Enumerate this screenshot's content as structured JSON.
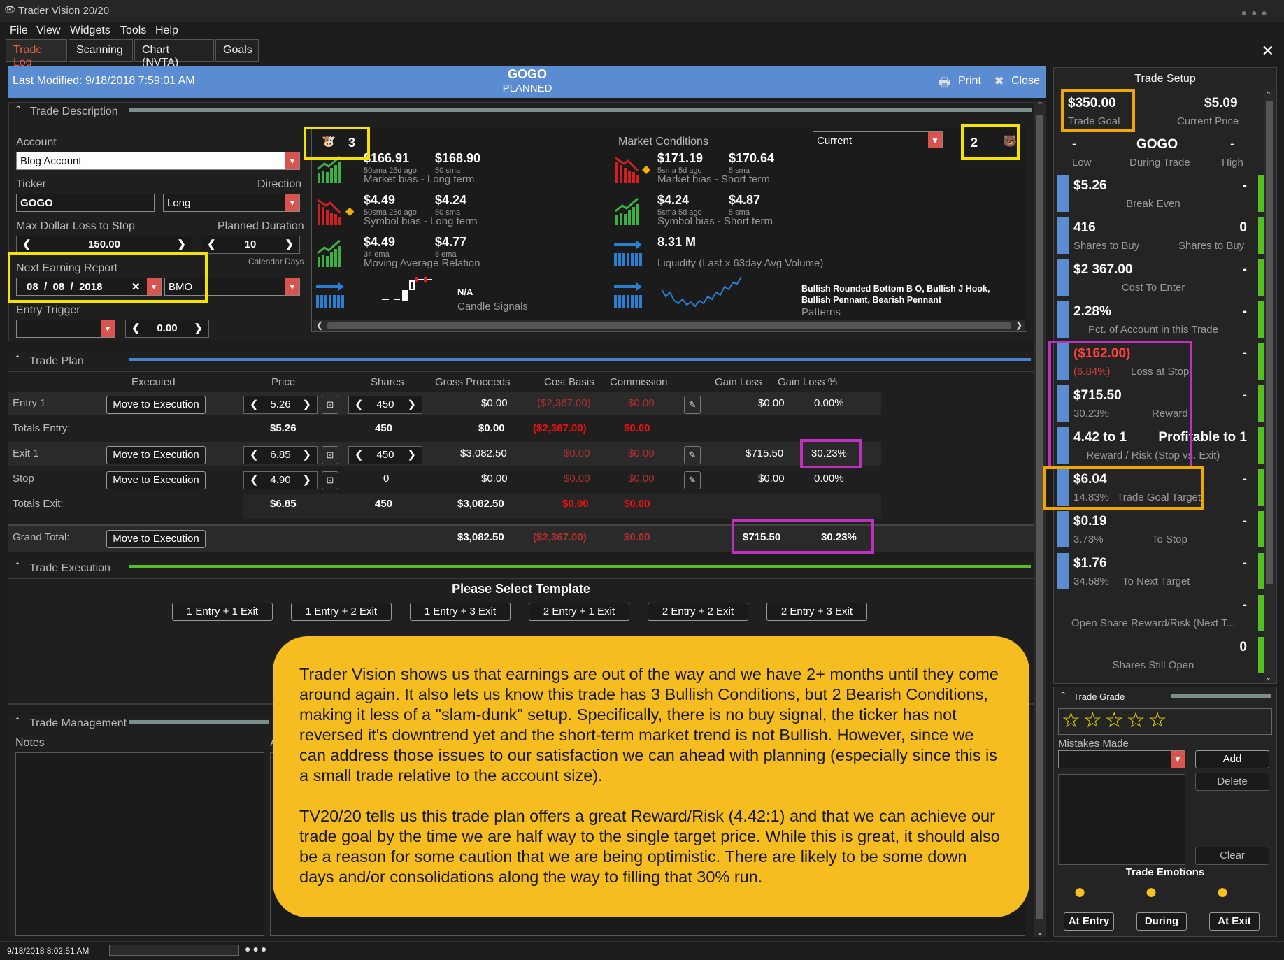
{
  "app": {
    "title": "Trader Vision 20/20"
  },
  "menu": [
    "File",
    "View",
    "Widgets",
    "Tools",
    "Help"
  ],
  "tabs": [
    "Trade Log",
    "Scanning",
    "Chart (NVTA)",
    "Goals"
  ],
  "header": {
    "last_modified": "Last Modified: 9/18/2018 7:59:01 AM",
    "ticker": "GOGO",
    "status": "PLANNED",
    "print": "Print",
    "close": "Close"
  },
  "trade_description": {
    "section": "Trade Description",
    "account_label": "Account",
    "account": "Blog Account",
    "ticker_label": "Ticker",
    "ticker": "GOGO",
    "direction_label": "Direction",
    "direction": "Long",
    "max_loss_label": "Max Dollar Loss to Stop",
    "max_loss": "150.00",
    "duration_label": "Planned Duration",
    "duration": "10",
    "duration_unit": "Calendar Days",
    "earning_label": "Next Earning Report",
    "earning_mm": "08",
    "earning_dd": "08",
    "earning_yy": "2018",
    "earning_time": "BMO",
    "entry_trigger_label": "Entry Trigger",
    "entry_trigger_value": "0.00"
  },
  "market": {
    "bull_count": "3",
    "bear_count": "2",
    "title": "Market Conditions",
    "mode": "Current",
    "cells": [
      {
        "v1": "$166.91",
        "s1": "50sma 25d ago",
        "v2": "$168.90",
        "s2": "50 sma",
        "desc": "Market bias - Long term"
      },
      {
        "v1": "$171.19",
        "s1": "5sma 5d ago",
        "v2": "$170.64",
        "s2": "5 sma",
        "desc": "Market bias - Short term"
      },
      {
        "v1": "$4.49",
        "s1": "50sma 25d ago",
        "v2": "$4.24",
        "s2": "50 sma",
        "desc": "Symbol bias - Long term"
      },
      {
        "v1": "$4.24",
        "s1": "5sma 5d ago",
        "v2": "$4.87",
        "s2": "5 sma",
        "desc": "Symbol bias - Short term"
      },
      {
        "v1": "$4.49",
        "s1": "34 ema",
        "v2": "$4.77",
        "s2": "8 ema",
        "desc": "Moving Average Relation"
      },
      {
        "v1": "8.31 M",
        "s1": "",
        "v2": "",
        "s2": "",
        "desc": "Liquidity (Last x 63day Avg Volume)"
      },
      {
        "v1": "N/A",
        "desc": "Candle Signals"
      },
      {
        "v1": "Bullish Rounded Bottom B O, Bullish J Hook,",
        "v2": "Bullish Pennant, Bearish Pennant",
        "desc": "Patterns"
      }
    ]
  },
  "trade_plan": {
    "section": "Trade Plan",
    "headers": [
      "Executed",
      "Price",
      "Shares",
      "Gross Proceeds",
      "Cost Basis",
      "Commission",
      "Gain Loss",
      "Gain Loss %"
    ],
    "move": "Move to Execution",
    "entry1": {
      "label": "Entry 1",
      "price": "5.26",
      "shares": "450",
      "gross": "$0.00",
      "cost": "($2,367.00)",
      "comm": "$0.00",
      "gl": "$0.00",
      "glp": "0.00%"
    },
    "totals_entry": {
      "label": "Totals Entry:",
      "price": "$5.26",
      "shares": "450",
      "gross": "$0.00",
      "cost": "($2,367.00)",
      "comm": "$0.00"
    },
    "exit1": {
      "label": "Exit 1",
      "price": "6.85",
      "shares": "450",
      "gross": "$3,082.50",
      "cost": "$0.00",
      "comm": "$0.00",
      "gl": "$715.50",
      "glp": "30.23%"
    },
    "stop": {
      "label": "Stop",
      "price": "4.90",
      "shares": "0",
      "gross": "$0.00",
      "cost": "$0.00",
      "comm": "$0.00",
      "gl": "$0.00",
      "glp": "0.00%"
    },
    "totals_exit": {
      "label": "Totals Exit:",
      "price": "$6.85",
      "shares": "450",
      "gross": "$3,082.50",
      "cost": "$0.00",
      "comm": "$0.00"
    },
    "grand": {
      "label": "Grand Total:",
      "gross": "$3,082.50",
      "cost": "($2,367.00)",
      "comm": "$0.00",
      "gl": "$715.50",
      "glp": "30.23%"
    }
  },
  "trade_execution": {
    "section": "Trade Execution",
    "prompt": "Please Select Template",
    "templates": [
      "1 Entry + 1 Exit",
      "1 Entry + 2 Exit",
      "1 Entry + 3 Exit",
      "2 Entry + 1 Exit",
      "2 Entry + 2 Exit",
      "2 Entry + 3 Exit"
    ]
  },
  "trade_management": {
    "section": "Trade Management",
    "notes": "Notes",
    "a": "A"
  },
  "note": {
    "p1": "Trader Vision shows us that earnings are out of the way and we have 2+ months until they come around again.  It also lets us know this trade has 3 Bullish Conditions, but 2 Bearish Conditions, making it less of a \"slam-dunk\" setup.  Specifically, there is no buy signal, the ticker has not reversed it's downtrend yet and the short-term market trend is not Bullish.  However, since we can address those issues to our satisfaction we can ahead with planning (especially since this is a small trade relative to the account size).",
    "p2": "TV20/20 tells us this trade plan offers a great Reward/Risk (4.42:1) and that we can achieve our trade goal by the time we are half way to the single target price.  While this is great, it should also be a reason for some caution that we are being optimistic.  There are likely to be some down days and/or consolidations along the way to filling that 30% run."
  },
  "setup": {
    "title": "Trade Setup",
    "goal": "$350.00",
    "goal_label": "Trade Goal",
    "price": "$5.09",
    "price_label": "Current Price",
    "low": "-",
    "ticker": "GOGO",
    "high": "-",
    "low_label": "Low",
    "during_label": "During Trade",
    "high_label": "High",
    "rows": [
      {
        "big": "$5.26",
        "right": "-",
        "sm": "Break Even"
      },
      {
        "big": "416",
        "right": "0",
        "sm_l": "Shares to Buy",
        "sm_r": "Shares to Buy"
      },
      {
        "big": "$2 367.00",
        "right": "-",
        "sm": "Cost To Enter"
      },
      {
        "big": "2.28%",
        "right": "-",
        "sm": "Pct. of Account in this Trade"
      },
      {
        "big": "($162.00)",
        "right": "-",
        "pct": "(6.84%)",
        "sm": "Loss at Stop"
      },
      {
        "big": "$715.50",
        "right": "-",
        "pct": "30.23%",
        "sm": "Reward"
      },
      {
        "big": "4.42 to 1",
        "right": "Profitable to 1",
        "sm": "Reward / Risk (Stop vs. Exit)"
      },
      {
        "big": "$6.04",
        "right": "-",
        "pct": "14.83%",
        "sm": "Trade Goal Target"
      },
      {
        "big": "$0.19",
        "right": "-",
        "pct": "3.73%",
        "sm": "To Stop"
      },
      {
        "big": "$1.76",
        "right": "-",
        "pct": "34.58%",
        "sm": "To Next Target"
      },
      {
        "big": "",
        "right": "-",
        "sm": "Open Share Reward/Risk (Next T..."
      },
      {
        "big": "",
        "right": "0",
        "sm": "Shares Still Open"
      }
    ]
  },
  "grade": {
    "title": "Trade Grade",
    "mistakes": "Mistakes Made",
    "add": "Add",
    "delete": "Delete",
    "clear": "Clear",
    "emotions": "Trade Emotions",
    "at_entry": "At Entry",
    "during": "During",
    "at_exit": "At Exit"
  },
  "status": {
    "time": "9/18/2018 8:02:51 AM"
  },
  "colors": {
    "accent": "#5b8bd0",
    "green": "#55c022",
    "annotation_yellow": "#f5e400",
    "annotation_magenta": "#c030c0",
    "note_bg": "#f5bd20"
  }
}
